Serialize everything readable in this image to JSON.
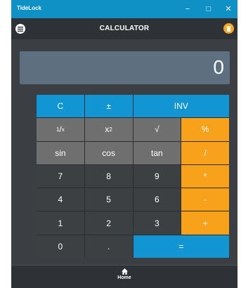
{
  "window": {
    "title": "TideLock",
    "minimize": "−",
    "maximize": "□",
    "close": "✕"
  },
  "header": {
    "title": "CALCULATOR",
    "menu_icon": "menu-icon",
    "delete_icon": "trash-icon"
  },
  "display": {
    "value": "0"
  },
  "keys": {
    "clear": "C",
    "sign": "±",
    "inv": "INV",
    "reciprocal_num": "1",
    "reciprocal_den": "x",
    "square_base": "x",
    "square_exp": "2",
    "sqrt": "√",
    "percent": "%",
    "sin": "sin",
    "cos": "cos",
    "tan": "tan",
    "divide": "/",
    "d7": "7",
    "d8": "8",
    "d9": "9",
    "multiply": "*",
    "d4": "4",
    "d5": "5",
    "d6": "6",
    "minus": "-",
    "d1": "1",
    "d2": "2",
    "d3": "3",
    "plus": "+",
    "d0": "0",
    "dot": ".",
    "equals": "="
  },
  "colors": {
    "accent_blue": "#1296d3",
    "operator_orange": "#f7a21a",
    "background": "#3b3e42"
  },
  "nav": {
    "home_label": "Home",
    "home_icon": "home-icon"
  }
}
